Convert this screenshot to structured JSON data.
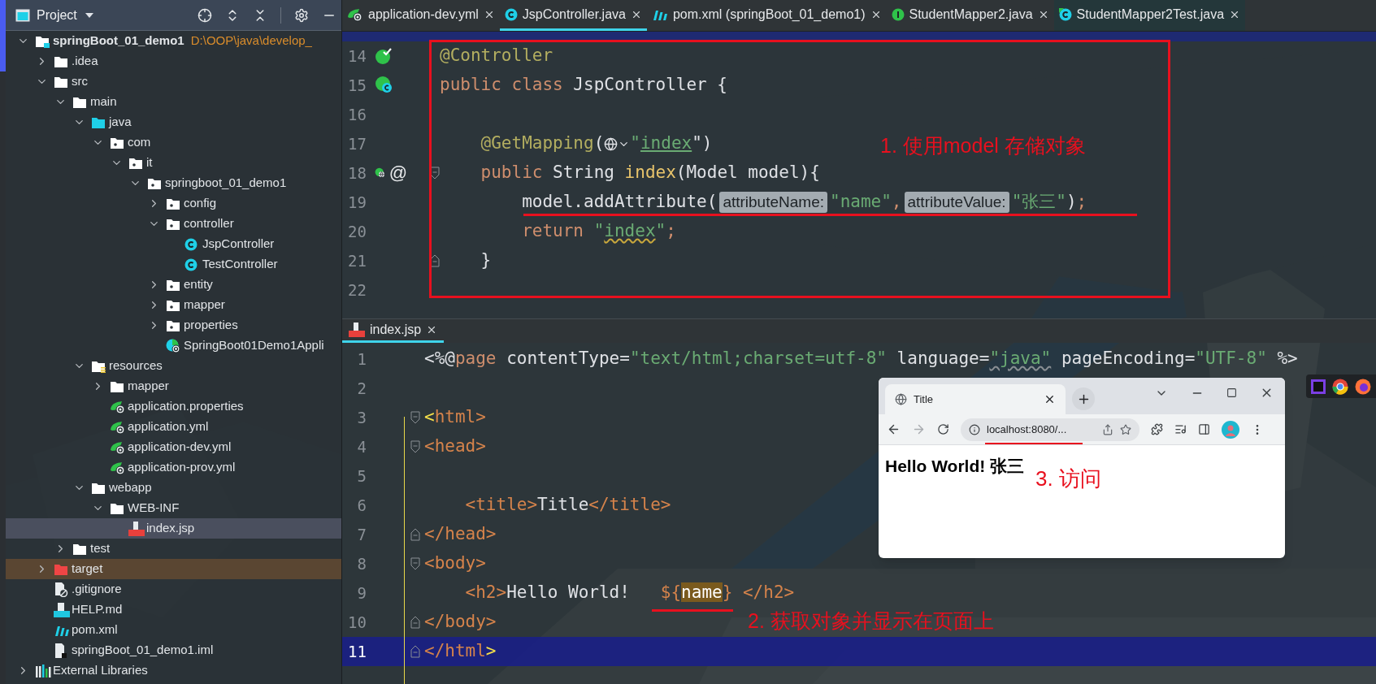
{
  "project": {
    "title": "Project",
    "tree": [
      {
        "label": "springBoot_01_demo1",
        "path": "D:\\OOP\\java\\develop_",
        "kind": "module",
        "expanded": true,
        "selected": false,
        "children": [
          {
            "label": ".idea",
            "kind": "folder",
            "expanded": false,
            "selected": false
          },
          {
            "label": "src",
            "kind": "folder",
            "expanded": true,
            "selected": false,
            "children": [
              {
                "label": "main",
                "kind": "folder",
                "expanded": true,
                "selected": false,
                "children": [
                  {
                    "label": "java",
                    "kind": "source-root",
                    "expanded": true,
                    "selected": false,
                    "children": [
                      {
                        "label": "com",
                        "kind": "package",
                        "expanded": true,
                        "selected": false,
                        "children": [
                          {
                            "label": "it",
                            "kind": "package",
                            "expanded": true,
                            "selected": false,
                            "children": [
                              {
                                "label": "springboot_01_demo1",
                                "kind": "package",
                                "expanded": true,
                                "selected": false,
                                "children": [
                                  {
                                    "label": "config",
                                    "kind": "package",
                                    "expanded": false,
                                    "selected": false
                                  },
                                  {
                                    "label": "controller",
                                    "kind": "package",
                                    "expanded": true,
                                    "selected": false,
                                    "children": [
                                      {
                                        "label": "JspController",
                                        "kind": "class",
                                        "selected": false
                                      },
                                      {
                                        "label": "TestController",
                                        "kind": "class",
                                        "selected": false
                                      }
                                    ]
                                  },
                                  {
                                    "label": "entity",
                                    "kind": "package",
                                    "expanded": false,
                                    "selected": false
                                  },
                                  {
                                    "label": "mapper",
                                    "kind": "package",
                                    "expanded": false,
                                    "selected": false
                                  },
                                  {
                                    "label": "properties",
                                    "kind": "package",
                                    "expanded": false,
                                    "selected": false
                                  },
                                  {
                                    "label": "SpringBoot01Demo1Appli",
                                    "kind": "boot-class",
                                    "selected": false
                                  }
                                ]
                              }
                            ]
                          }
                        ]
                      }
                    ]
                  },
                  {
                    "label": "resources",
                    "kind": "resources-root",
                    "expanded": true,
                    "selected": false,
                    "children": [
                      {
                        "label": "mapper",
                        "kind": "folder",
                        "expanded": false,
                        "selected": false
                      },
                      {
                        "label": "application.properties",
                        "kind": "spring-config",
                        "selected": false
                      },
                      {
                        "label": "application.yml",
                        "kind": "spring-config",
                        "selected": false
                      },
                      {
                        "label": "application-dev.yml",
                        "kind": "spring-config",
                        "selected": false
                      },
                      {
                        "label": "application-prov.yml",
                        "kind": "spring-config",
                        "selected": false
                      }
                    ]
                  },
                  {
                    "label": "webapp",
                    "kind": "folder",
                    "expanded": true,
                    "selected": false,
                    "children": [
                      {
                        "label": "WEB-INF",
                        "kind": "folder",
                        "expanded": true,
                        "selected": false,
                        "children": [
                          {
                            "label": "index.jsp",
                            "kind": "jsp",
                            "selected": true
                          }
                        ]
                      }
                    ]
                  }
                ]
              },
              {
                "label": "test",
                "kind": "folder",
                "expanded": false,
                "selected": false
              }
            ]
          },
          {
            "label": "target",
            "kind": "excluded",
            "expanded": false,
            "selected": false
          },
          {
            "label": ".gitignore",
            "kind": "gitignore",
            "selected": false
          },
          {
            "label": "HELP.md",
            "kind": "markdown",
            "selected": false
          },
          {
            "label": "pom.xml",
            "kind": "maven",
            "selected": false
          },
          {
            "label": "springBoot_01_demo1.iml",
            "kind": "iml",
            "selected": false
          }
        ]
      },
      {
        "label": "External Libraries",
        "kind": "libraries",
        "expanded": false,
        "selected": false
      }
    ]
  },
  "editor_tabs": [
    {
      "label": "application-dev.yml",
      "kind": "spring-config",
      "selected": false
    },
    {
      "label": "JspController.java",
      "kind": "class",
      "selected": true
    },
    {
      "label": "pom.xml (springBoot_01_demo1)",
      "kind": "maven",
      "selected": false
    },
    {
      "label": "StudentMapper2.java",
      "kind": "interface",
      "selected": false
    },
    {
      "label": "StudentMapper2Test.java",
      "kind": "test-class",
      "selected": false
    }
  ],
  "top_editor": {
    "lines": [
      {
        "number": "14",
        "gutter": [
          {
            "kind": "bean"
          }
        ],
        "segments": [
          {
            "text": "@Controller",
            "kind": "annotation"
          }
        ]
      },
      {
        "number": "15",
        "gutter": [
          {
            "kind": "class-bean"
          }
        ],
        "segments": [
          {
            "text": "public class",
            "kind": "keyword"
          },
          {
            "text": " JspController {",
            "kind": "plain"
          }
        ]
      },
      {
        "number": "16"
      },
      {
        "number": "17",
        "segments": [
          {
            "text": "    @GetMapping",
            "kind": "annotation"
          },
          {
            "text": "(",
            "kind": "plain"
          },
          {
            "kind": "globe-inlay"
          },
          {
            "text": "\"",
            "kind": "string"
          },
          {
            "text": "index",
            "kind": "link"
          },
          {
            "text": "\")",
            "kind": "plain"
          }
        ]
      },
      {
        "number": "18",
        "gutter": [
          {
            "kind": "web-bean"
          },
          {
            "kind": "marker",
            "text": "@"
          }
        ],
        "fold": {
          "kind": "open"
        },
        "segments": [
          {
            "text": "    public",
            "kind": "keyword"
          },
          {
            "text": " String ",
            "kind": "plain"
          },
          {
            "text": "index",
            "kind": "method"
          },
          {
            "text": "(Model model){",
            "kind": "plain"
          }
        ]
      },
      {
        "number": "19",
        "segments": [
          {
            "text": "        model.addAttribute(",
            "kind": "plain"
          },
          {
            "text": "attributeName:",
            "kind": "hint"
          },
          {
            "text": "\"name\"",
            "kind": "string"
          },
          {
            "text": ",",
            "kind": "keyword"
          },
          {
            "text": "attributeValue:",
            "kind": "hint"
          },
          {
            "text": "\"张三\"",
            "kind": "string"
          },
          {
            "text": ")",
            "kind": "plain"
          },
          {
            "text": ";",
            "kind": "keyword"
          }
        ]
      },
      {
        "number": "20",
        "segments": [
          {
            "text": "        return",
            "kind": "keyword"
          },
          {
            "text": " \"",
            "kind": "string"
          },
          {
            "text": "index",
            "kind": "typo"
          },
          {
            "text": "\"",
            "kind": "string"
          },
          {
            "text": ";",
            "kind": "keyword"
          }
        ]
      },
      {
        "number": "21",
        "fold": {
          "kind": "close"
        },
        "segments": [
          {
            "text": "    }",
            "kind": "plain"
          }
        ]
      },
      {
        "number": "22"
      }
    ]
  },
  "bottom_tab": {
    "label": "index.jsp",
    "kind": "jsp",
    "selected": true
  },
  "bottom_editor": {
    "lines": [
      {
        "number": "1",
        "current": false,
        "segments": [
          {
            "text": "<%@",
            "kind": "plain"
          },
          {
            "text": "page",
            "kind": "keyword"
          },
          {
            "text": " contentType=",
            "kind": "plain"
          },
          {
            "text": "\"text/html;charset=utf-8\"",
            "kind": "string"
          },
          {
            "text": " language=",
            "kind": "plain"
          },
          {
            "text": "\"java\"",
            "kind": "grey-typo"
          },
          {
            "text": " pageEncoding=",
            "kind": "plain"
          },
          {
            "text": "\"UTF-8\"",
            "kind": "string"
          },
          {
            "text": " %>",
            "kind": "plain"
          }
        ]
      },
      {
        "number": "2",
        "current": false
      },
      {
        "number": "3",
        "current": false,
        "fold": {
          "kind": "open"
        },
        "segments": [
          {
            "text": "<",
            "kind": "brace"
          },
          {
            "text": "html>",
            "kind": "tag"
          }
        ]
      },
      {
        "number": "4",
        "current": false,
        "fold": {
          "kind": "open"
        },
        "segments": [
          {
            "text": "<head>",
            "kind": "tag"
          }
        ]
      },
      {
        "number": "5",
        "current": false
      },
      {
        "number": "6",
        "current": false,
        "segments": [
          {
            "text": "    <title>",
            "kind": "tag"
          },
          {
            "text": "Title",
            "kind": "plain"
          },
          {
            "text": "</title>",
            "kind": "tag"
          }
        ]
      },
      {
        "number": "7",
        "current": false,
        "fold": {
          "kind": "close"
        },
        "segments": [
          {
            "text": "</head>",
            "kind": "tag"
          }
        ]
      },
      {
        "number": "8",
        "current": false,
        "fold": {
          "kind": "open"
        },
        "segments": [
          {
            "text": "<body>",
            "kind": "tag"
          }
        ]
      },
      {
        "number": "9",
        "current": false,
        "segments": [
          {
            "text": "    <h2>",
            "kind": "tag"
          },
          {
            "text": "Hello World!   ",
            "kind": "plain"
          },
          {
            "text": "${",
            "kind": "tag"
          },
          {
            "text": "name",
            "kind": "highlight"
          },
          {
            "text": "} </h2>",
            "kind": "tag"
          }
        ]
      },
      {
        "number": "10",
        "current": false,
        "fold": {
          "kind": "close"
        },
        "segments": [
          {
            "text": "</body>",
            "kind": "tag"
          }
        ]
      },
      {
        "number": "11",
        "current": true,
        "fold": {
          "kind": "close"
        },
        "segments": [
          {
            "text": "</html",
            "kind": "tag"
          },
          {
            "text": ">",
            "kind": "brace"
          }
        ]
      }
    ]
  },
  "annotations": [
    {
      "text": "1. 使用model 存储对象"
    },
    {
      "text": "2. 获取对象并显示在页面上"
    },
    {
      "text": "3. 访问"
    }
  ],
  "browser": {
    "tab_title": "Title",
    "url": "localhost:8080/...",
    "heading": "Hello World! 张三"
  }
}
